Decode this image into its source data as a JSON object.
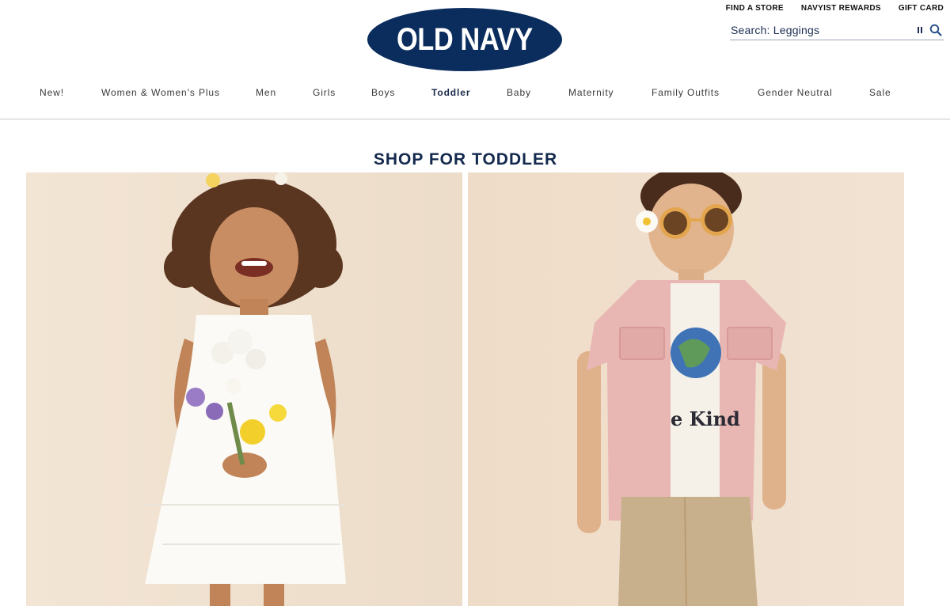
{
  "brand": {
    "logo_text": "OLD NAVY",
    "logo_color": "#0b2d5e"
  },
  "utility_links": [
    "FIND A STORE",
    "NAVYIST REWARDS",
    "GIFT CARD"
  ],
  "search": {
    "placeholder": "Search: Leggings",
    "pause_icon": "pause-icon",
    "search_icon": "search-icon"
  },
  "nav": {
    "items": [
      {
        "label": "New!"
      },
      {
        "label": "Women & Women's Plus"
      },
      {
        "label": "Men"
      },
      {
        "label": "Girls"
      },
      {
        "label": "Boys"
      },
      {
        "label": "Toddler",
        "active": true
      },
      {
        "label": "Baby"
      },
      {
        "label": "Maternity"
      },
      {
        "label": "Family Outfits"
      },
      {
        "label": "Gender Neutral"
      },
      {
        "label": "Sale"
      }
    ]
  },
  "main": {
    "title": "SHOP FOR TODDLER",
    "tiles": [
      {
        "image": "Toddler girl in white dress holding flowers"
      },
      {
        "image": "Toddler boy in sunglasses, pink shirt and \"Be Kind\" tee"
      }
    ],
    "shirt_text": "e Kind"
  },
  "colors": {
    "navy": "#13294d",
    "tile_background": "#efe0cf",
    "divider": "#c9c9c9"
  }
}
